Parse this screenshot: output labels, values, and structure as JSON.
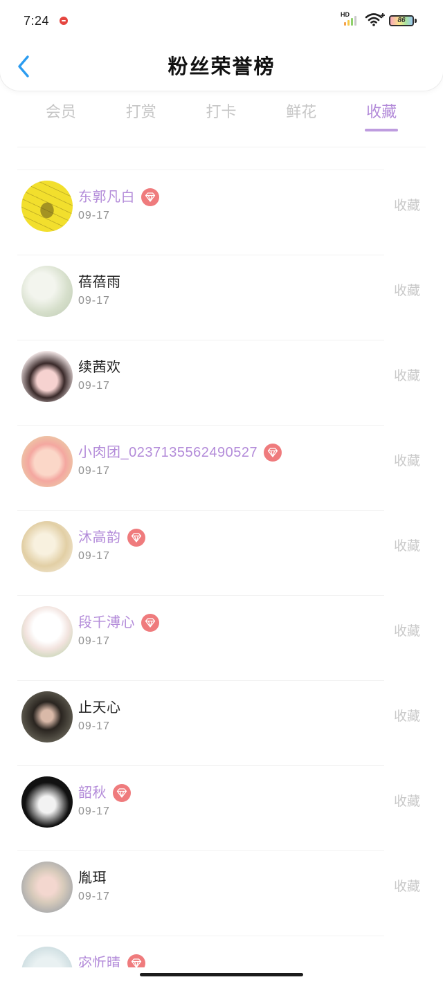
{
  "status_bar": {
    "time": "7:24",
    "network_label": "HD",
    "battery_level": "86"
  },
  "header": {
    "title": "粉丝荣誉榜"
  },
  "tabs": [
    {
      "label": "会员",
      "active": false
    },
    {
      "label": "打赏",
      "active": false
    },
    {
      "label": "打卡",
      "active": false
    },
    {
      "label": "鲜花",
      "active": false
    },
    {
      "label": "收藏",
      "active": true
    }
  ],
  "fans": [
    {
      "name": "东郭凡白",
      "date": "09-17",
      "vip": true,
      "action": "收藏"
    },
    {
      "name": "蓓蓓雨",
      "date": "09-17",
      "vip": false,
      "action": "收藏"
    },
    {
      "name": "续茜欢",
      "date": "09-17",
      "vip": false,
      "action": "收藏"
    },
    {
      "name": "小肉团_0237135562490527",
      "date": "09-17",
      "vip": true,
      "action": "收藏"
    },
    {
      "name": "沐高韵",
      "date": "09-17",
      "vip": true,
      "action": "收藏"
    },
    {
      "name": "段千溥心",
      "date": "09-17",
      "vip": true,
      "action": "收藏"
    },
    {
      "name": "止天心",
      "date": "09-17",
      "vip": false,
      "action": "收藏"
    },
    {
      "name": "韶秋",
      "date": "09-17",
      "vip": true,
      "action": "收藏"
    },
    {
      "name": "胤珥",
      "date": "09-17",
      "vip": false,
      "action": "收藏"
    },
    {
      "name": "宓忻晴",
      "vip": true
    }
  ],
  "theme": {
    "accent": "#b38bd9",
    "back_arrow": "#2b9cf0",
    "badge": "#ef7b7d",
    "tab_inactive": "#c6c6c6",
    "text": "#222222",
    "muted": "#8f8f8f",
    "action": "#c9c9c9"
  },
  "icons": {
    "back": "chevron-left-icon",
    "vip_badge": "diamond-badge-icon",
    "notification": "notification-app-icon",
    "signal": "signal-icon",
    "wifi": "wifi-icon",
    "battery": "battery-icon"
  }
}
